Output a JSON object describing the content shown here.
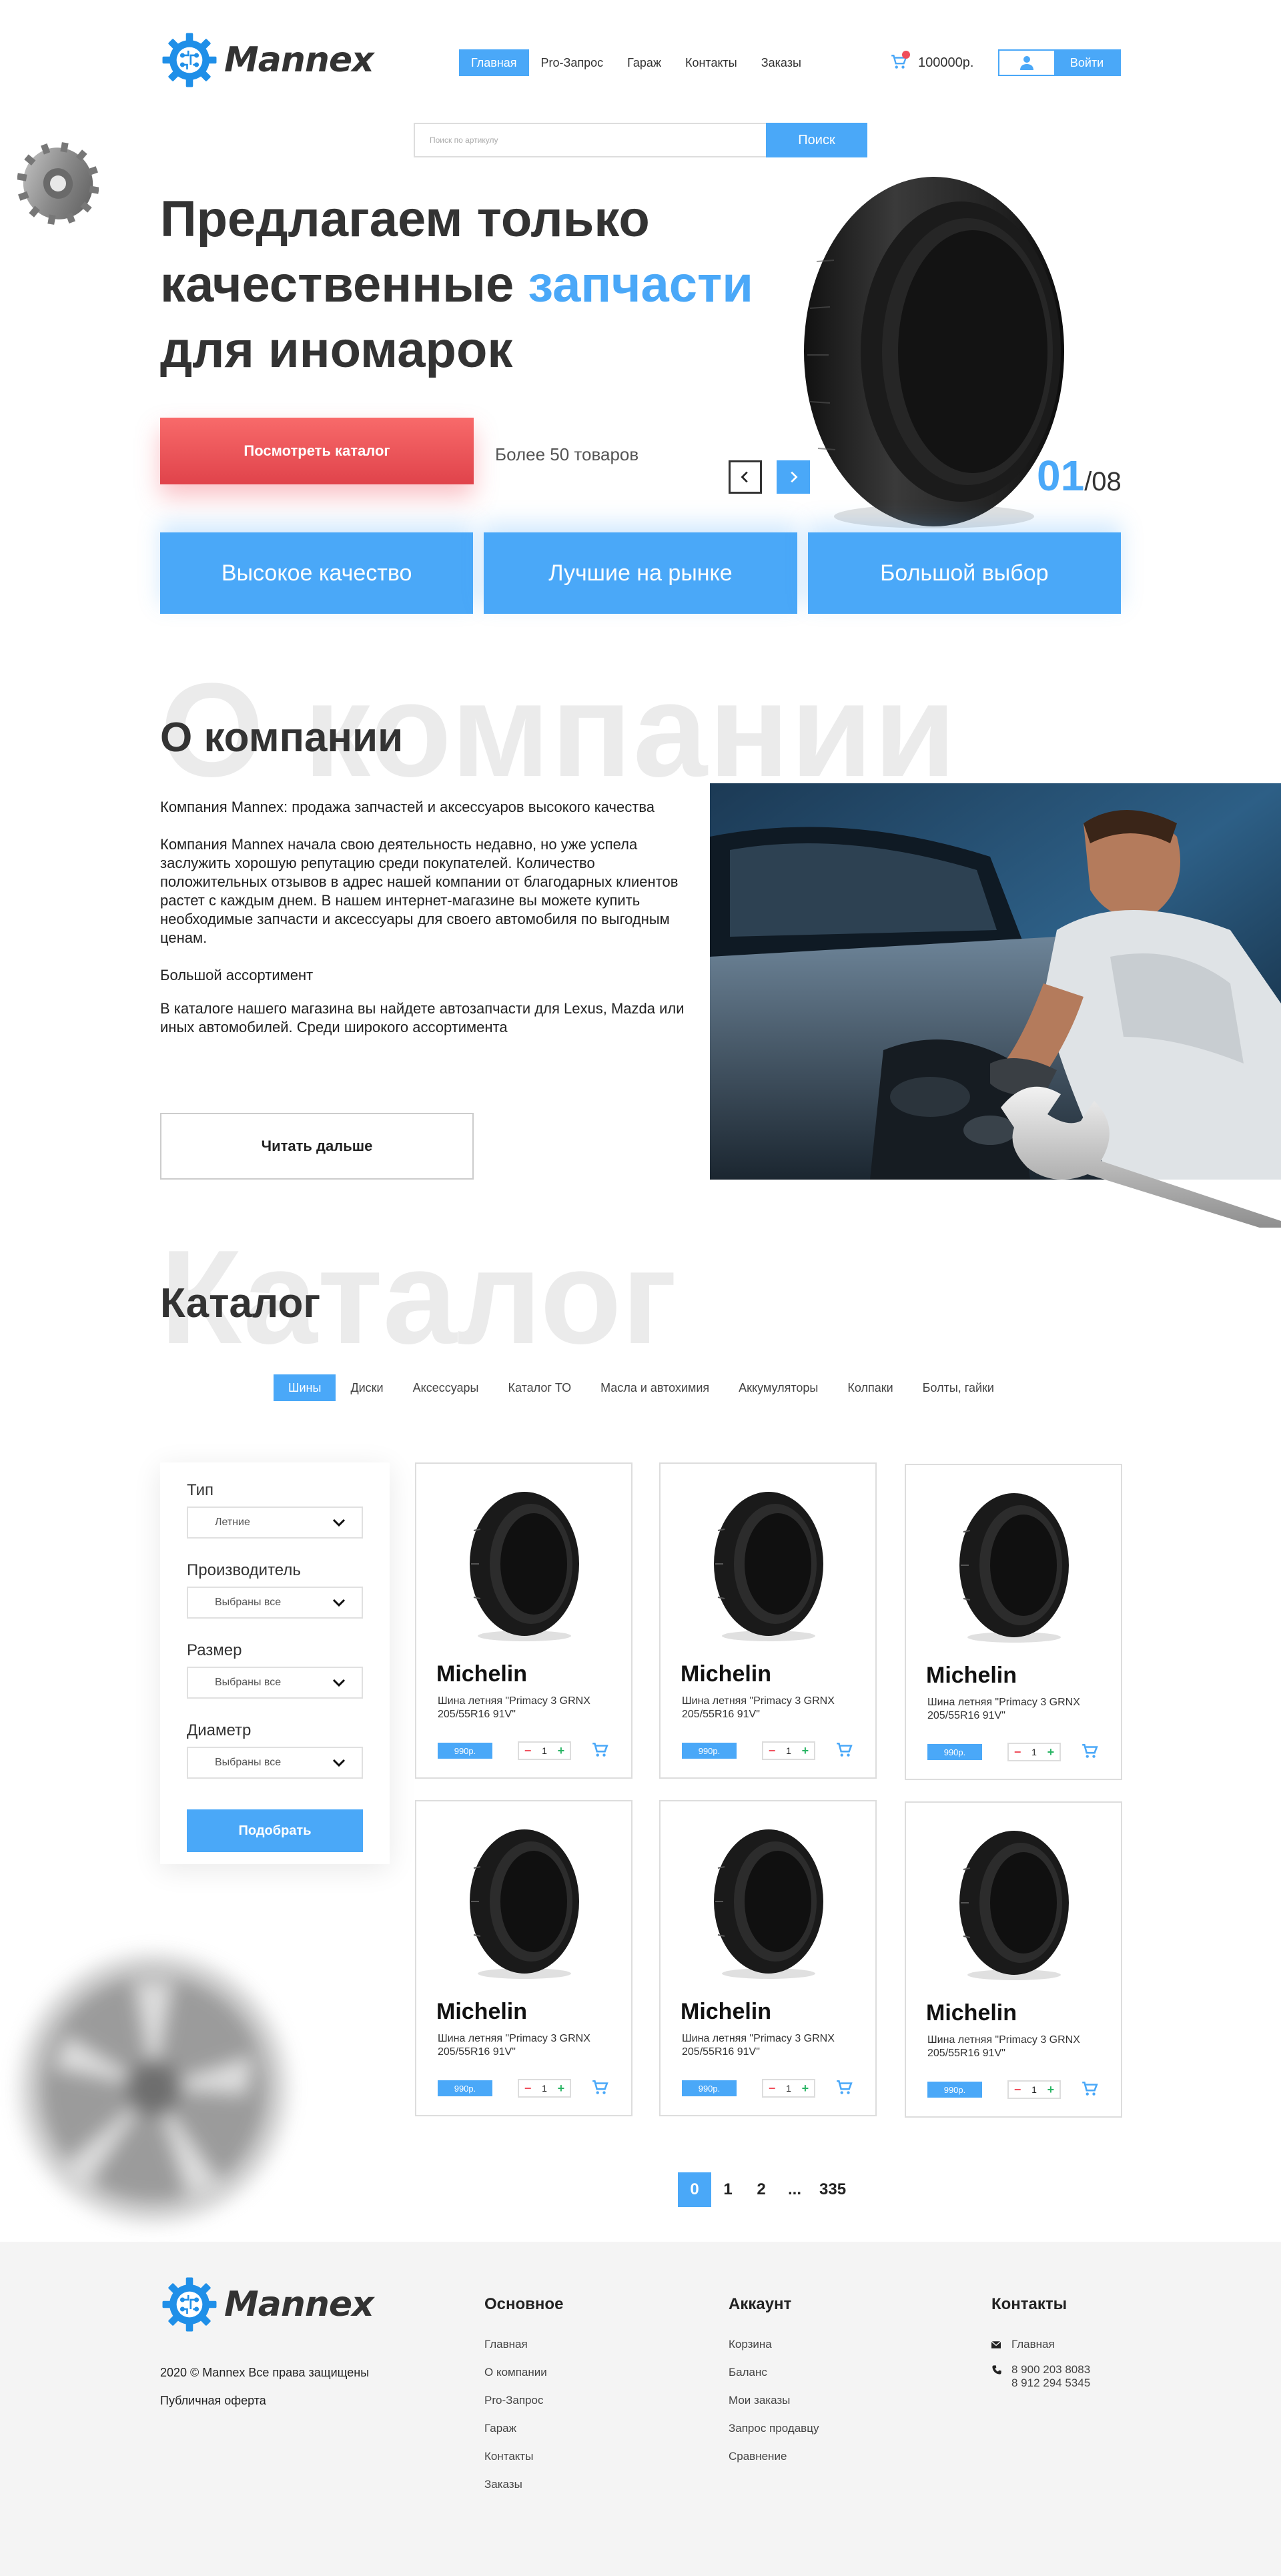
{
  "brand": {
    "name": "Mannex",
    "accent_color": "#4aa8f8",
    "red_color": "#f04e5b"
  },
  "header": {
    "nav": [
      {
        "label": "Главная",
        "active": true
      },
      {
        "label": "Pro-Запрос",
        "active": false
      },
      {
        "label": "Гараж",
        "active": false
      },
      {
        "label": "Контакты",
        "active": false
      },
      {
        "label": "Заказы",
        "active": false
      }
    ],
    "cart_balance": "100000р.",
    "login_label": "Войти"
  },
  "search": {
    "placeholder": "Поиск по артикулу",
    "button_label": "Поиск"
  },
  "hero": {
    "title_line1": "Предлагаем только",
    "title_line2_plain": "качественные ",
    "title_line2_accent": "запчасти",
    "title_line3": "для иномарок",
    "catalog_button": "Посмотреть каталог",
    "items_count": "Более 50 товаров",
    "slide_current": "01",
    "slide_total": "/08",
    "features": [
      "Высокое качество",
      "Лучшие на рынке",
      "Большой выбор"
    ]
  },
  "about": {
    "bg_word": "О компании",
    "title": "О компании",
    "paragraphs": [
      "Компания Mannex: продажа запчастей и аксессуаров высокого качества",
      "Компания Mannex начала свою деятельность недавно, но уже успела заслужить хорошую репутацию среди покупателей. Количество положительных отзывов в адрес нашей компании от благодарных клиентов растет с каждым днем. В нашем интернет-магазине вы можете купить необходимые запчасти и аксессуары для своего автомобиля по выгодным ценам.",
      "Большой ассортимент",
      "В каталоге нашего магазина вы найдете автозапчасти для Lexus, Mazda или иных автомобилей. Среди широкого ассортимента"
    ],
    "read_more": "Читать дальше"
  },
  "catalog": {
    "bg_word": "Каталог",
    "title": "Каталог",
    "tabs": [
      {
        "label": "Шины",
        "active": true
      },
      {
        "label": "Диски",
        "active": false
      },
      {
        "label": "Аксессуары",
        "active": false
      },
      {
        "label": "Каталог ТО",
        "active": false
      },
      {
        "label": "Масла и автохимия",
        "active": false
      },
      {
        "label": "Аккумуляторы",
        "active": false
      },
      {
        "label": "Колпаки",
        "active": false
      },
      {
        "label": "Болты, гайки",
        "active": false
      }
    ],
    "filters": [
      {
        "label": "Тип",
        "value": "Летние"
      },
      {
        "label": "Производитель",
        "value": "Выбраны все"
      },
      {
        "label": "Размер",
        "value": "Выбраны все"
      },
      {
        "label": "Диаметр",
        "value": "Выбраны все"
      }
    ],
    "filter_submit": "Подобрать",
    "products": [
      {
        "brand": "Michelin",
        "desc": "Шина летняя \"Primacy 3 GRNX 205/55R16 91V\"",
        "price": "990р.",
        "qty": "1"
      },
      {
        "brand": "Michelin",
        "desc": "Шина летняя \"Primacy 3 GRNX 205/55R16 91V\"",
        "price": "990р.",
        "qty": "1"
      },
      {
        "brand": "Michelin",
        "desc": "Шина летняя \"Primacy 3 GRNX 205/55R16 91V\"",
        "price": "990р.",
        "qty": "1"
      },
      {
        "brand": "Michelin",
        "desc": "Шина летняя \"Primacy 3 GRNX 205/55R16 91V\"",
        "price": "990р.",
        "qty": "1"
      },
      {
        "brand": "Michelin",
        "desc": "Шина летняя \"Primacy 3 GRNX 205/55R16 91V\"",
        "price": "990р.",
        "qty": "1"
      },
      {
        "brand": "Michelin",
        "desc": "Шина летняя \"Primacy 3 GRNX 205/55R16 91V\"",
        "price": "990р.",
        "qty": "1"
      }
    ],
    "pagination": [
      {
        "label": "0",
        "active": true
      },
      {
        "label": "1",
        "active": false
      },
      {
        "label": "2",
        "active": false
      },
      {
        "label": "...",
        "active": false
      },
      {
        "label": "335",
        "active": false
      }
    ]
  },
  "footer": {
    "copyright": "2020 © Mannex Все права защищены",
    "offer": "Публичная оферта",
    "col_main": {
      "title": "Основное",
      "links": [
        "Главная",
        "О компании",
        "Pro-Запрос",
        "Гараж",
        "Контакты",
        "Заказы"
      ]
    },
    "col_account": {
      "title": "Аккаунт",
      "links": [
        "Корзина",
        "Баланс",
        "Мои заказы",
        "Запрос продавцу",
        "Сравнение"
      ]
    },
    "col_contacts": {
      "title": "Контакты",
      "address": "Главная",
      "phone1": "8 900 203 8083",
      "phone2": "8 912 294 5345"
    }
  }
}
